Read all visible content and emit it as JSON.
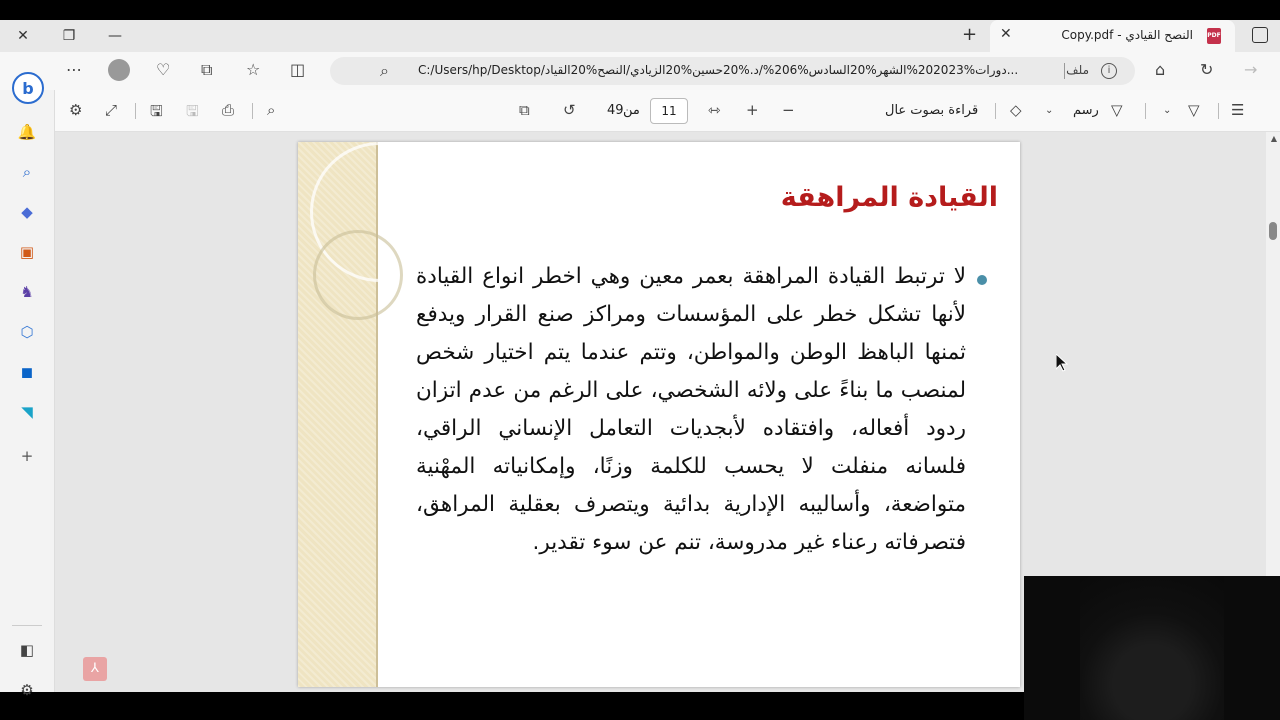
{
  "tab": {
    "title": "النصح القيادي - Copy.pdf",
    "pdf_badge": "PDF"
  },
  "address": {
    "label": "ملف",
    "url": "C:/Users/hp/Desktop/دورات%202023%الشهر%20السادس%206%/د.%20حسين%20الزيادي/النصح%20القياد..."
  },
  "toolbar": {
    "read_aloud": "قراءة بصوت عال",
    "draw": "رسم",
    "page_current": "11",
    "of_label": "من",
    "page_total": "49"
  },
  "slide": {
    "title": "القيادة المراهقة",
    "body": "لا ترتبط القيادة المراهقة بعمر معين وهي اخطر انواع القيادة لأنها تشكل خطر على المؤسسات ومراكز صنع القرار ويدفع ثمنها الباهظ الوطن والمواطن، وتتم عندما يتم  اختيار شخص لمنصب ما بناءً على ولائه الشخصي، على الرغم من عدم اتزان ردود أفعاله، وافتقاده لأبجديات التعامل الإنساني الراقي، فلسانه منفلت لا يحسب للكلمة وزنًا، وإمكانياته المهْنية متواضعة، وأساليبه الإدارية بدائية ويتصرف بعقلية المراهق، فتصرفاته رعناء غير مدروسة، تنم عن سوء تقدير."
  },
  "colors": {
    "title_red": "#b51c1c",
    "bullet": "#4a8fa8",
    "band": "#efe4c2"
  }
}
